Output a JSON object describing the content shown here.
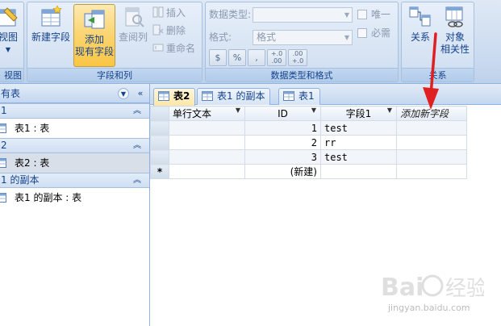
{
  "ribbon": {
    "views_group_label": "视图",
    "views_button_label": "视图",
    "fields_group_label": "字段和列",
    "new_field_label": "新建字段",
    "add_existing_label_1": "添加",
    "add_existing_label_2": "现有字段",
    "lookup_column_label": "查阅列",
    "insert_label": "插入",
    "delete_label": "删除",
    "rename_label": "重命名",
    "datatype_group_label": "数据类型和格式",
    "datatype_label": "数据类型:",
    "datatype_value": "",
    "format_label": "格式:",
    "format_value": "格式",
    "unique_label": "唯一",
    "required_label": "必需",
    "currency_label": "$",
    "percent_label": "%",
    "comma_label": ",",
    "inc_decimal_label": "+.0 .00",
    "dec_decimal_label": ".00 +.0",
    "relations_group_label": "关系",
    "relationships_label": "关系",
    "object_dep_label_1": "对象",
    "object_dep_label_2": "相关性"
  },
  "nav": {
    "header": "有表",
    "groups": [
      {
        "title": "1",
        "items": [
          {
            "label": "表1 : 表"
          }
        ]
      },
      {
        "title": "2",
        "items": [
          {
            "label": "表2 : 表"
          }
        ]
      },
      {
        "title": "1 的副本",
        "items": [
          {
            "label": "表1 的副本 : 表"
          }
        ]
      }
    ]
  },
  "tabs": [
    {
      "label": "表2"
    },
    {
      "label": "表1 的副本"
    },
    {
      "label": "表1"
    }
  ],
  "grid": {
    "columns": [
      "单行文本",
      "ID",
      "字段1",
      "添加新字段"
    ],
    "rows": [
      {
        "text": "",
        "id": "1",
        "field1": "test"
      },
      {
        "text": "",
        "id": "2",
        "field1": "rr"
      },
      {
        "text": "",
        "id": "3",
        "field1": "test"
      }
    ],
    "new_row_marker": "*",
    "new_row_label": "(新建)"
  },
  "watermark": {
    "brand": "Baidu经验",
    "url": "jingyan.baidu.com"
  },
  "colors": {
    "ribbon_text": "#15428b",
    "active_button": "#fbd675",
    "annotation_arrow": "#e02020"
  }
}
